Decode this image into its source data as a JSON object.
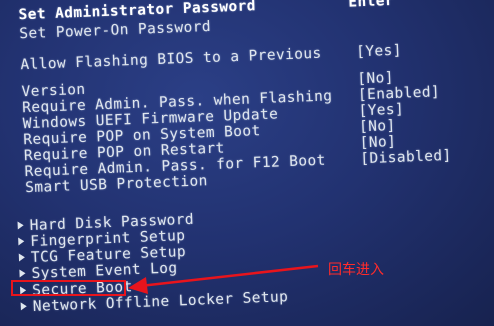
{
  "top_items": [
    {
      "label": "Set Administrator Password",
      "value": "Enter"
    },
    {
      "label": "Set Power-On Password",
      "value": ""
    }
  ],
  "settings": [
    {
      "label": "Allow Flashing BIOS to a Previous",
      "value": "[Yes]"
    },
    {
      "label": "Version",
      "value": "[No]"
    },
    {
      "label": "Require Admin. Pass. when Flashing",
      "value": "[Enabled]"
    },
    {
      "label": "Windows UEFI Firmware Update",
      "value": "[Yes]"
    },
    {
      "label": "Require POP on System Boot",
      "value": "[No]"
    },
    {
      "label": "Require POP on Restart",
      "value": "[No]"
    },
    {
      "label": "Require Admin. Pass. for F12 Boot",
      "value": "[Disabled]"
    },
    {
      "label": "Smart USB Protection",
      "value": ""
    }
  ],
  "submenus": [
    {
      "label": "Hard Disk Password"
    },
    {
      "label": "Fingerprint Setup"
    },
    {
      "label": "TCG Feature Setup"
    },
    {
      "label": "System Event Log"
    },
    {
      "label": "Secure Boot"
    },
    {
      "label": "Network Offline Locker Setup"
    }
  ],
  "annotation": {
    "text": "回车进入",
    "color": "#e8141c"
  }
}
